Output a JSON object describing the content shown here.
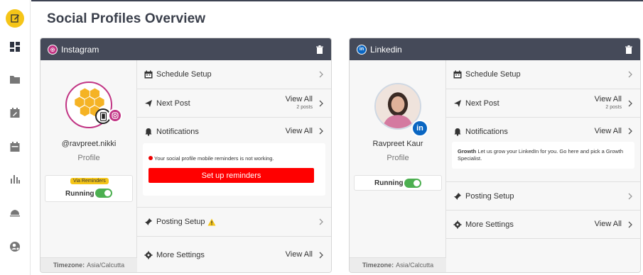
{
  "page_title": "Social Profiles Overview",
  "sidebar": {
    "items": [
      {
        "icon": "edit-icon",
        "active": true
      },
      {
        "icon": "dashboard-icon"
      },
      {
        "icon": "folder-icon"
      },
      {
        "icon": "calendar-edit-icon"
      },
      {
        "icon": "calendar-icon"
      },
      {
        "icon": "analytics-icon"
      },
      {
        "icon": "cloud-icon"
      },
      {
        "icon": "user-settings-icon"
      }
    ]
  },
  "cards": [
    {
      "network": "Instagram",
      "handle": "@ravpreet.nikki",
      "profile_label": "Profile",
      "via_tag": "Via Reminders",
      "status": "Running",
      "timezone_label": "Timezone:",
      "timezone": "Asia/Calcutta",
      "rows": {
        "schedule": "Schedule Setup",
        "next_post": "Next Post",
        "next_post_view_all": "View All",
        "next_post_count": "2 posts",
        "notifications": "Notifications",
        "notifications_view_all": "View All",
        "notification_message": "Your social profile mobile reminders is not working.",
        "setup_button": "Set up reminders",
        "posting_setup": "Posting Setup",
        "more_settings": "More Settings",
        "more_settings_view_all": "View All"
      }
    },
    {
      "network": "Linkedin",
      "handle": "Ravpreet Kaur",
      "profile_label": "Profile",
      "status": "Running",
      "timezone_label": "Timezone:",
      "timezone": "Asia/Calcutta",
      "rows": {
        "schedule": "Schedule Setup",
        "next_post": "Next Post",
        "next_post_view_all": "View All",
        "next_post_count": "2 posts",
        "notifications": "Notifications",
        "notifications_view_all": "View All",
        "growth_title": "Growth",
        "growth_message": "Let us grow your LinkedIn for you. Go here and pick a Growth Specialist.",
        "posting_setup": "Posting Setup",
        "more_settings": "More Settings",
        "more_settings_view_all": "View All"
      }
    }
  ],
  "colors": {
    "header": "#454a59",
    "accent": "#f5c518",
    "instagram": "#c13584",
    "linkedin": "#0a66c2",
    "toggle_on": "#4caf50",
    "alert": "#ff0000"
  }
}
